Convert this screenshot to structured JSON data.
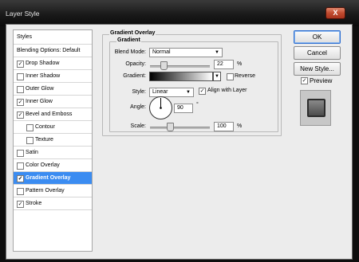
{
  "window": {
    "title": "Layer Style",
    "close_glyph": "X"
  },
  "styles_list": {
    "header": "Styles",
    "items": [
      {
        "label": "Blending Options: Default",
        "checkbox": false,
        "checked": false,
        "indent": 0,
        "selected": false
      },
      {
        "label": "Drop Shadow",
        "checkbox": true,
        "checked": true,
        "indent": 0,
        "selected": false
      },
      {
        "label": "Inner Shadow",
        "checkbox": true,
        "checked": false,
        "indent": 0,
        "selected": false
      },
      {
        "label": "Outer Glow",
        "checkbox": true,
        "checked": false,
        "indent": 0,
        "selected": false
      },
      {
        "label": "Inner Glow",
        "checkbox": true,
        "checked": true,
        "indent": 0,
        "selected": false
      },
      {
        "label": "Bevel and Emboss",
        "checkbox": true,
        "checked": true,
        "indent": 0,
        "selected": false
      },
      {
        "label": "Contour",
        "checkbox": true,
        "checked": false,
        "indent": 1,
        "selected": false
      },
      {
        "label": "Texture",
        "checkbox": true,
        "checked": false,
        "indent": 1,
        "selected": false
      },
      {
        "label": "Satin",
        "checkbox": true,
        "checked": false,
        "indent": 0,
        "selected": false
      },
      {
        "label": "Color Overlay",
        "checkbox": true,
        "checked": false,
        "indent": 0,
        "selected": false
      },
      {
        "label": "Gradient Overlay",
        "checkbox": true,
        "checked": true,
        "indent": 0,
        "selected": true
      },
      {
        "label": "Pattern Overlay",
        "checkbox": true,
        "checked": false,
        "indent": 0,
        "selected": false
      },
      {
        "label": "Stroke",
        "checkbox": true,
        "checked": true,
        "indent": 0,
        "selected": false
      }
    ]
  },
  "panel": {
    "outer_title": "Gradient Overlay",
    "inner_title": "Gradient",
    "blend_mode": {
      "label": "Blend Mode:",
      "value": "Normal"
    },
    "opacity": {
      "label": "Opacity:",
      "value": "22",
      "unit": "%",
      "fraction": 0.22
    },
    "gradient": {
      "label": "Gradient:",
      "reverse_label": "Reverse",
      "reverse_checked": false
    },
    "style": {
      "label": "Style:",
      "value": "Linear",
      "align_label": "Align with Layer",
      "align_checked": true
    },
    "angle": {
      "label": "Angle:",
      "value": "90",
      "unit": "°"
    },
    "scale": {
      "label": "Scale:",
      "value": "100",
      "unit": "%",
      "fraction": 0.33
    }
  },
  "buttons": {
    "ok": "OK",
    "cancel": "Cancel",
    "new_style": "New Style...",
    "preview_label": "Preview",
    "preview_checked": true
  },
  "check_glyph": "✓",
  "dropdown_arrow": "▼"
}
